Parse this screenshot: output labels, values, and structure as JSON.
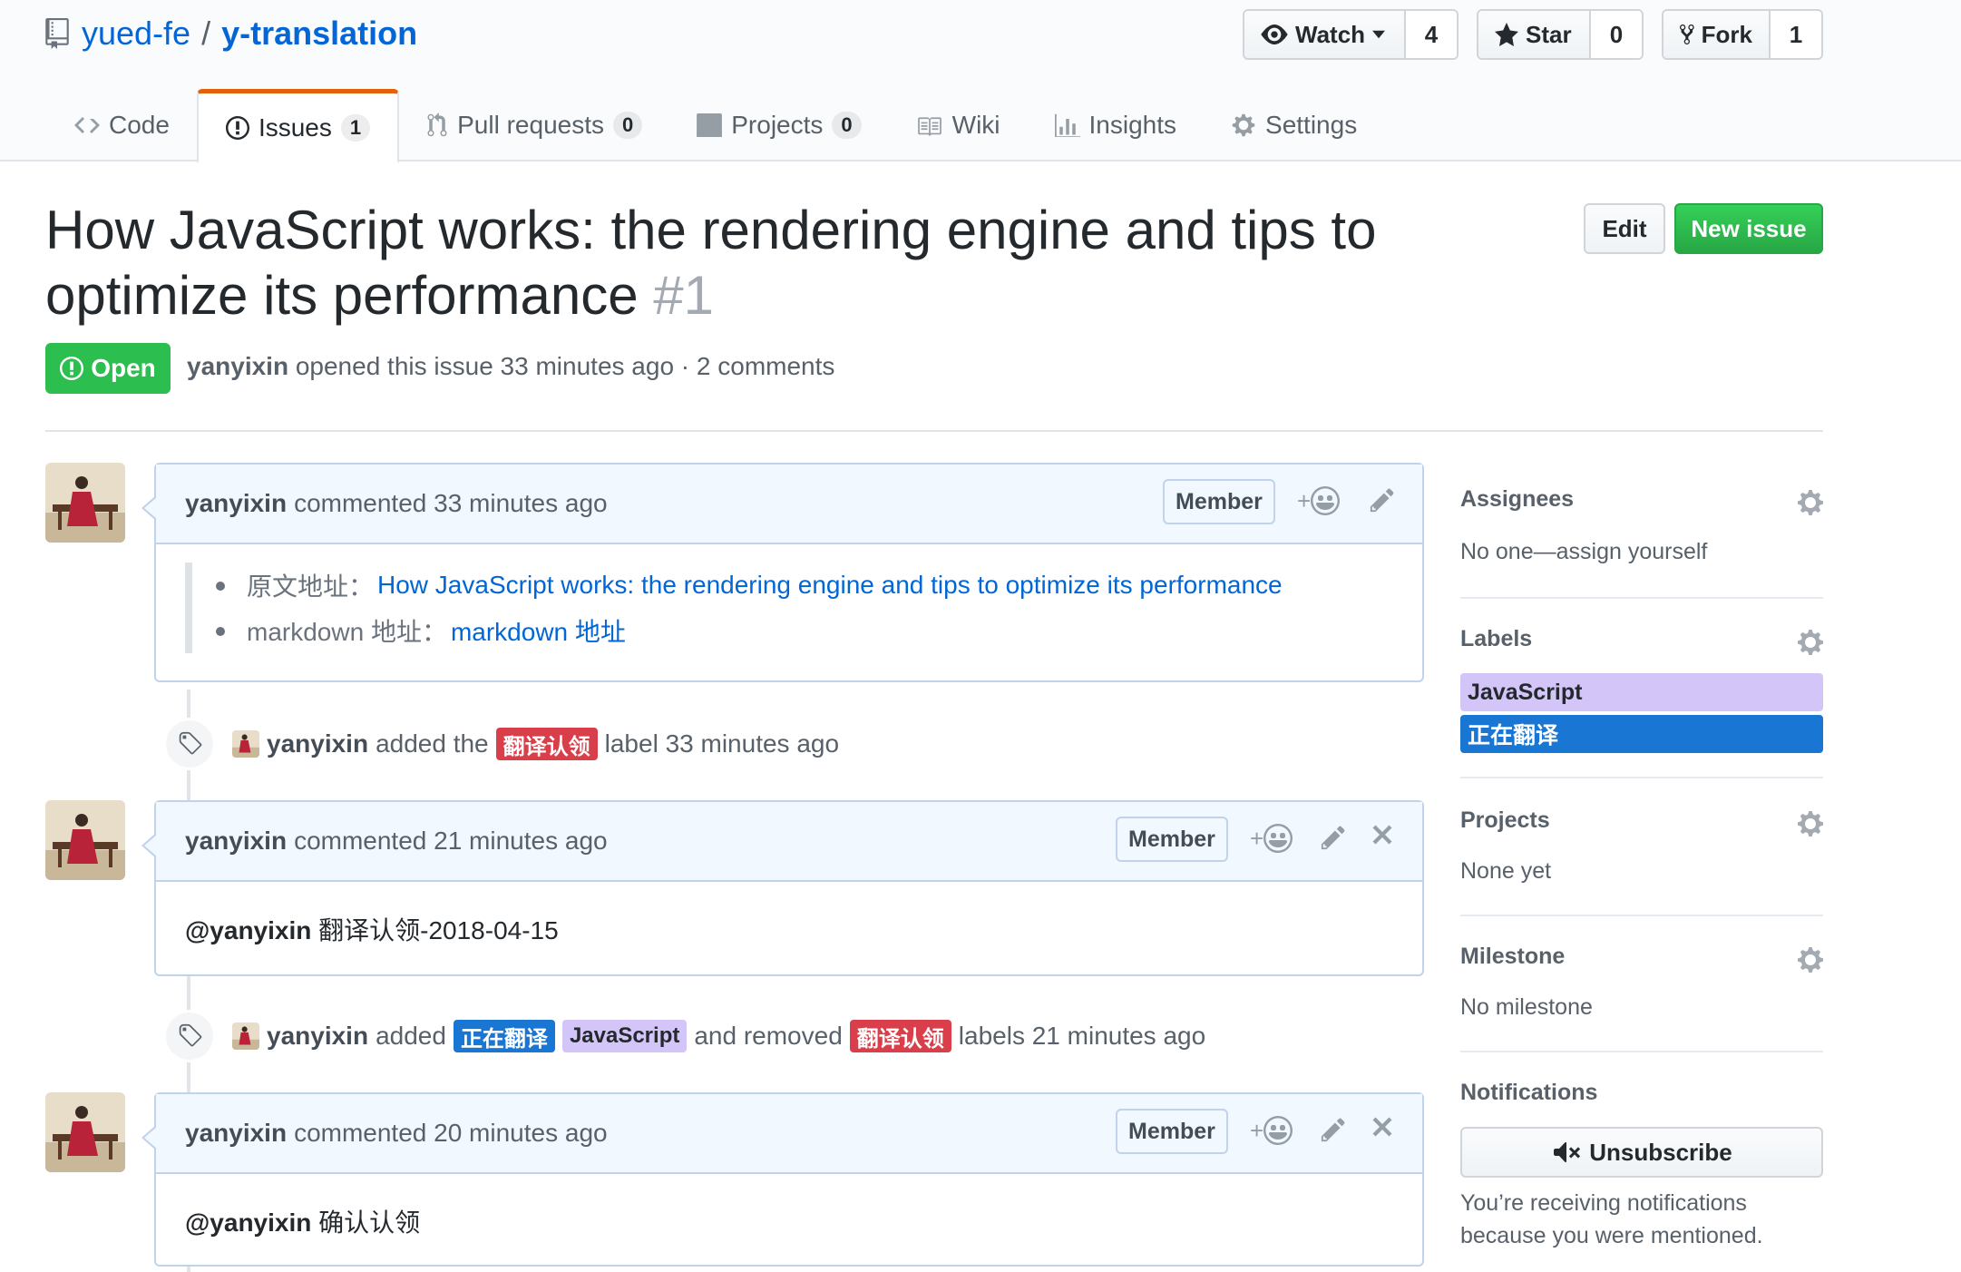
{
  "repo": {
    "owner": "yued-fe",
    "separator": "/",
    "name": "y-translation"
  },
  "actions": {
    "watch": {
      "label": "Watch",
      "count": "4"
    },
    "star": {
      "label": "Star",
      "count": "0"
    },
    "fork": {
      "label": "Fork",
      "count": "1"
    }
  },
  "tabs": [
    {
      "label": "Code",
      "icon": "code-icon"
    },
    {
      "label": "Issues",
      "count": "1",
      "icon": "issue-opened-icon"
    },
    {
      "label": "Pull requests",
      "count": "0",
      "icon": "git-pull-request-icon"
    },
    {
      "label": "Projects",
      "count": "0",
      "icon": "project-icon"
    },
    {
      "label": "Wiki",
      "icon": "book-icon"
    },
    {
      "label": "Insights",
      "icon": "graph-icon"
    },
    {
      "label": "Settings",
      "icon": "gear-icon"
    }
  ],
  "issue": {
    "title": "How JavaScript works: the rendering engine and tips to optimize its performance",
    "number": "#1",
    "edit_label": "Edit",
    "new_issue_label": "New issue",
    "state": "Open",
    "author": "yanyixin",
    "meta": "opened this issue 33 minutes ago · 2 comments"
  },
  "comments": [
    {
      "author": "yanyixin",
      "time": "commented 33 minutes ago",
      "badge": "Member",
      "quote_items": [
        {
          "prefix": "原文地址：",
          "link": "How JavaScript works: the rendering engine and tips to optimize its performance"
        },
        {
          "prefix": "markdown 地址：",
          "link": "markdown 地址"
        }
      ]
    },
    {
      "author": "yanyixin",
      "time": "commented 21 minutes ago",
      "badge": "Member",
      "mention": "@yanyixin",
      "text": "翻译认领-2018-04-15"
    },
    {
      "author": "yanyixin",
      "time": "commented 20 minutes ago",
      "badge": "Member",
      "mention": "@yanyixin",
      "text": "确认认领"
    }
  ],
  "events": [
    {
      "actor": "yanyixin",
      "text_before": "added the",
      "label": "翻译认领",
      "text_after": "label 33 minutes ago"
    },
    {
      "actor": "yanyixin",
      "text_before": "added",
      "added_labels": [
        "正在翻译",
        "JavaScript"
      ],
      "text_middle": "and removed",
      "removed_label": "翻译认领",
      "text_after": "labels 21 minutes ago"
    }
  ],
  "sidebar": {
    "assignees": {
      "heading": "Assignees",
      "value": "No one—assign yourself"
    },
    "labels": {
      "heading": "Labels",
      "items": [
        "JavaScript",
        "正在翻译"
      ]
    },
    "projects": {
      "heading": "Projects",
      "value": "None yet"
    },
    "milestone": {
      "heading": "Milestone",
      "value": "No milestone"
    },
    "notifications": {
      "heading": "Notifications",
      "button": "Unsubscribe",
      "reason_line1": "You’re receiving notifications",
      "reason_line2": "because you were mentioned."
    }
  },
  "colors": {
    "label_red": "#d93f4a",
    "label_blue": "#1976d2",
    "label_purple": "#d4c5f9",
    "open_green": "#2cbe4e",
    "link_blue": "#0366d6",
    "tab_accent": "#e36209"
  }
}
